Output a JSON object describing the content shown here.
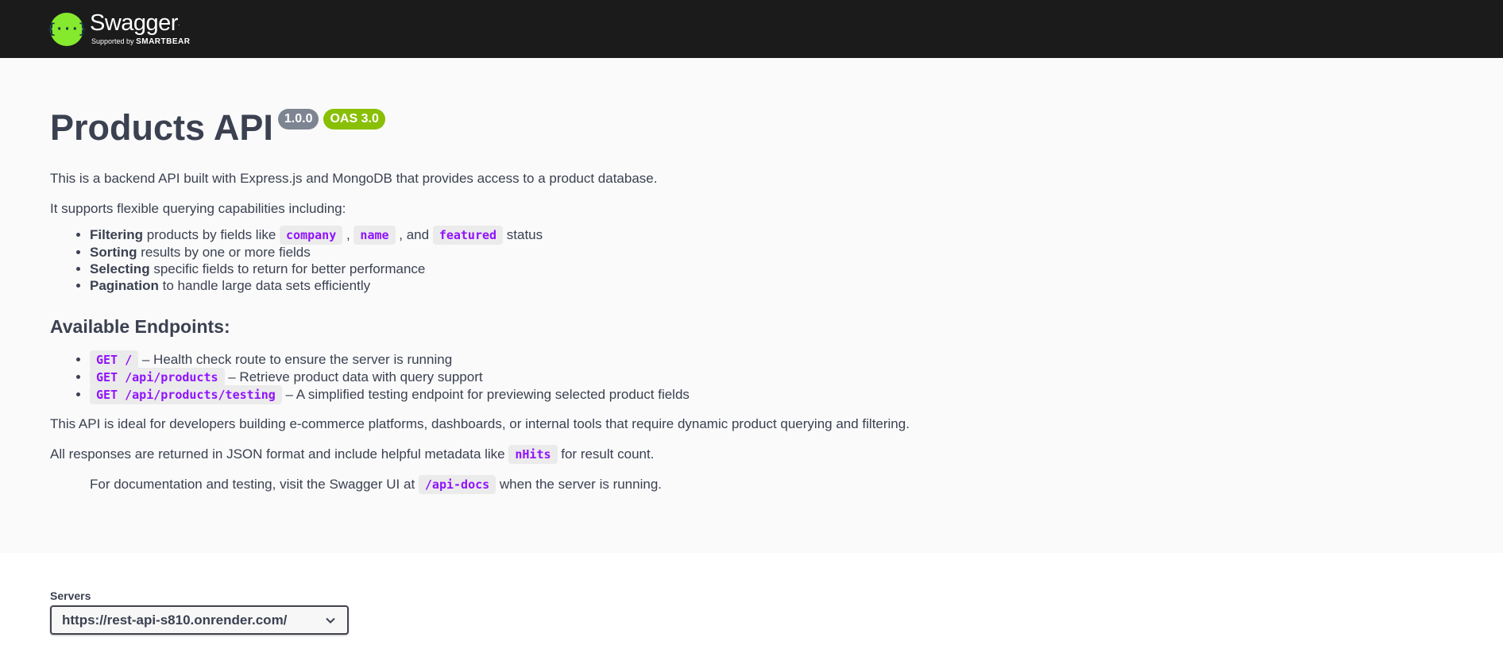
{
  "topbar": {
    "logo_title": "Swagger",
    "logo_tm": ".",
    "logo_sub_prefix": "Supported by",
    "logo_sub_brand": "SMARTBEAR",
    "logo_icon": "{···}"
  },
  "info": {
    "title": "Products API",
    "version_badge": "1.0.0",
    "oas_badge": "OAS 3.0",
    "intro": "This is a backend API built with Express.js and MongoDB that provides access to a product database.",
    "supports": "It supports flexible querying capabilities including:",
    "features": {
      "filtering_bold": "Filtering",
      "filtering_text": " products by fields like ",
      "code_company": "company",
      "sep1": " , ",
      "code_name": "name",
      "sep2": " , and ",
      "code_featured": "featured",
      "filtering_end": " status",
      "sorting_bold": "Sorting",
      "sorting_text": " results by one or more fields",
      "selecting_bold": "Selecting",
      "selecting_text": " specific fields to return for better performance",
      "pagination_bold": "Pagination",
      "pagination_text": " to handle large data sets efficiently"
    },
    "endpoints_heading": "Available Endpoints:",
    "endpoints": [
      {
        "code": "GET /",
        "desc": " – Health check route to ensure the server is running"
      },
      {
        "code": "GET /api/products",
        "desc": " – Retrieve product data with query support"
      },
      {
        "code": "GET /api/products/testing",
        "desc": " – A simplified testing endpoint for previewing selected product fields"
      }
    ],
    "ideal": "This API is ideal for developers building e-commerce platforms, dashboards, or internal tools that require dynamic product querying and filtering.",
    "json_prefix": "All responses are returned in JSON format and include helpful metadata like ",
    "json_code": "nHits",
    "json_suffix": " for result count.",
    "docs_prefix": "For documentation and testing, visit the Swagger UI at ",
    "docs_code": "/api-docs",
    "docs_suffix": " when the server is running."
  },
  "servers": {
    "label": "Servers",
    "selected": "https://rest-api-s810.onrender.com/"
  },
  "colors": {
    "topbar": "#1b1b1b",
    "logo_green": "#85ea2d",
    "badge_version": "#7d8492",
    "badge_oas": "#89bf04",
    "code_text": "#9012fe"
  }
}
